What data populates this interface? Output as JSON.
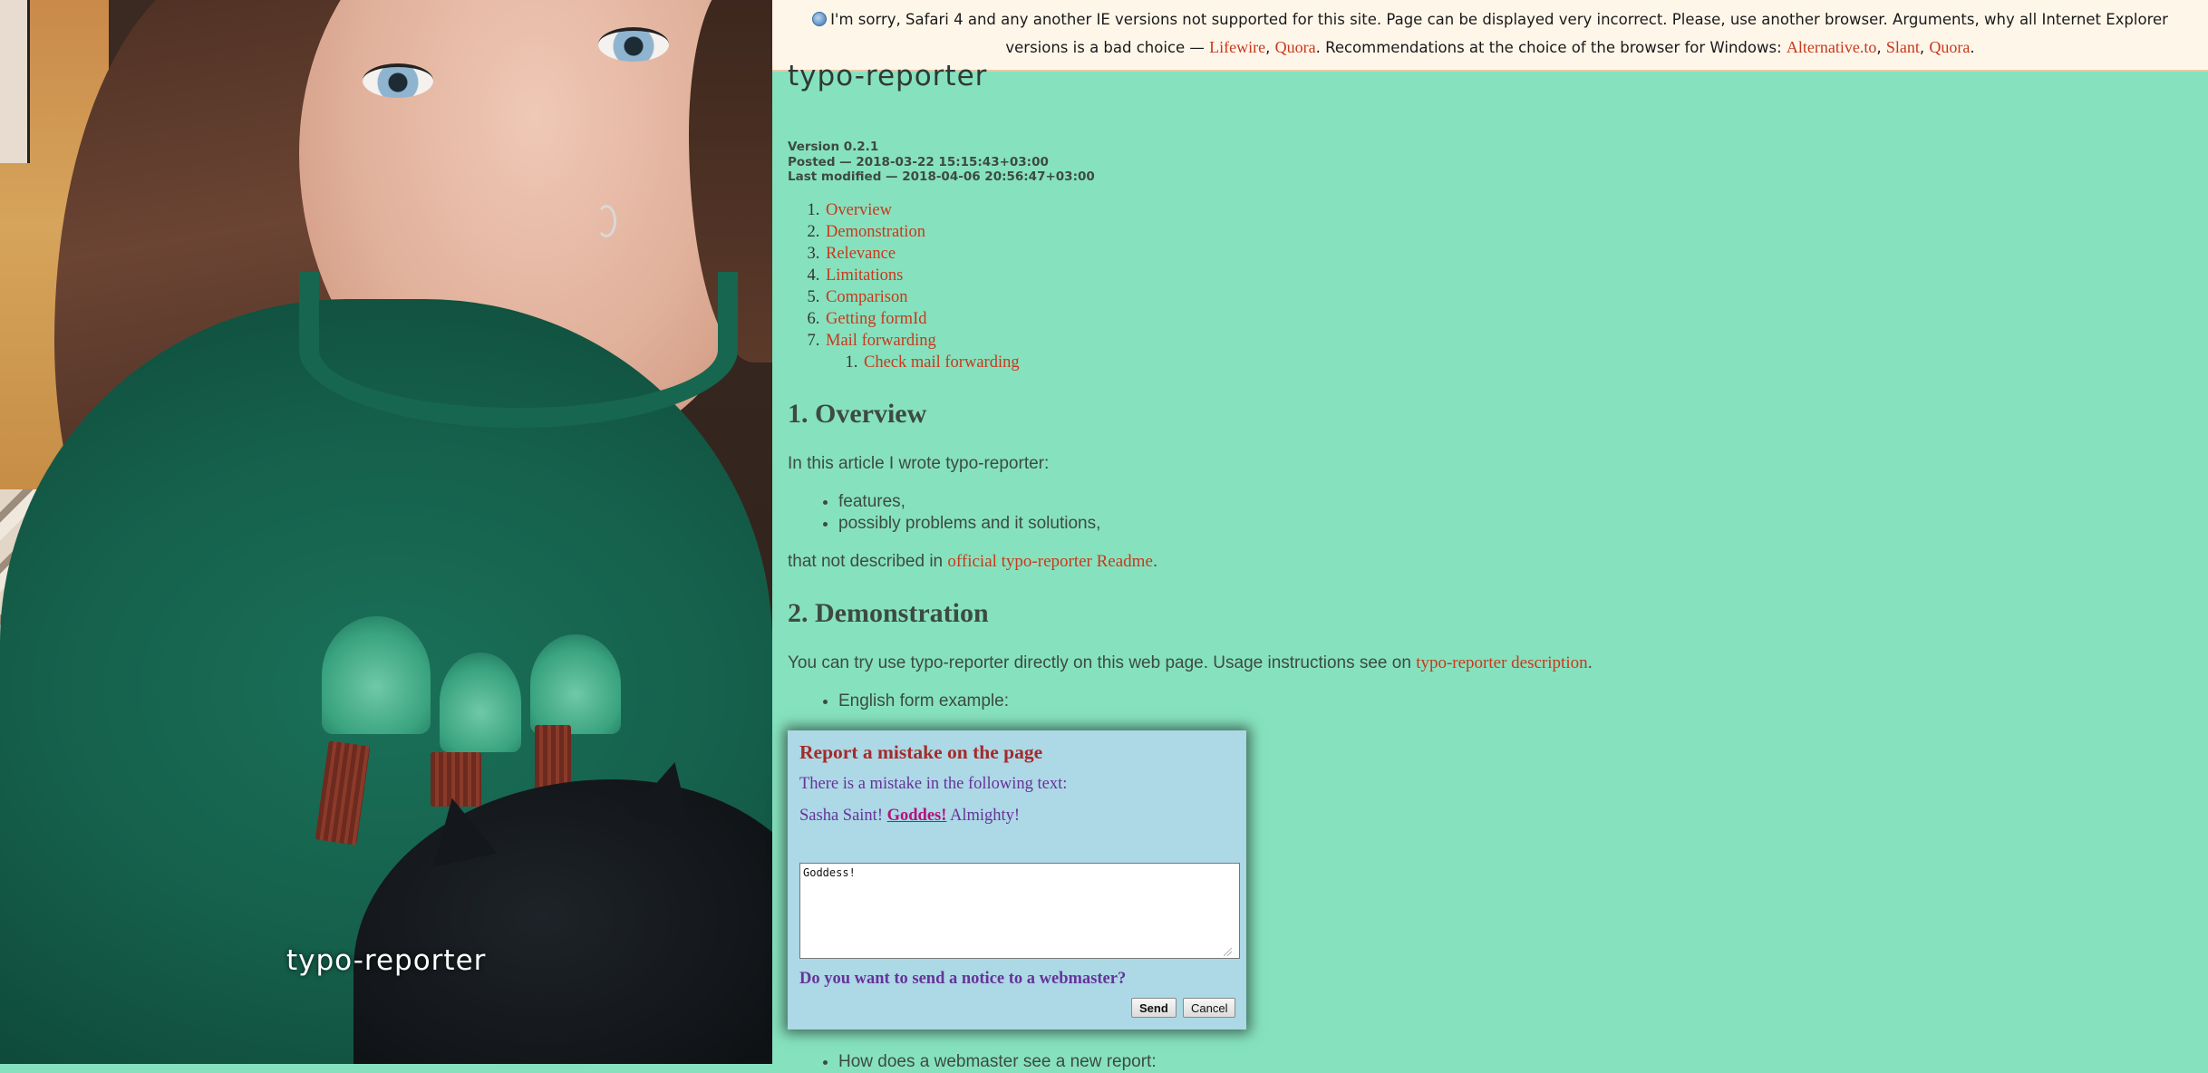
{
  "banner": {
    "text_before": "I'm sorry, Safari 4 and any another IE versions not supported for this site. Page can be displayed very incorrect. Please, use another browser. Arguments, why all Internet Explorer versions is a bad choice — ",
    "link_lifewire": "Lifewire",
    "sep1": ", ",
    "link_quora1": "Quora",
    "text_mid": ". Recommendations at the choice of the browser for Windows: ",
    "link_alternative": "Alternative.to",
    "sep2": ", ",
    "link_slant": "Slant",
    "sep3": ", ",
    "link_quora2": "Quora",
    "text_end": "."
  },
  "photo": {
    "caption": "typo-reporter"
  },
  "page": {
    "title": "typo-reporter",
    "version": "Version 0.2.1",
    "posted": "Posted — 2018-03-22 15:15:43+03:00",
    "modified": "Last modified — 2018-04-06 20:56:47+03:00"
  },
  "toc": {
    "items": [
      "Overview",
      "Demonstration",
      "Relevance",
      "Limitations",
      "Comparison",
      "Getting formId",
      "Mail forwarding"
    ],
    "subitems": [
      "Check mail forwarding"
    ]
  },
  "overview": {
    "heading": "1. Overview",
    "intro": "In this article I wrote typo-reporter:",
    "bullets": [
      "features,",
      "possibly problems and it solutions,"
    ],
    "outro_text": "that not described in ",
    "outro_link": "official typo-reporter Readme",
    "outro_end": "."
  },
  "demonstration": {
    "heading": "2. Demonstration",
    "text": "You can try use typo-reporter directly on this web page. Usage instructions see on ",
    "link": "typo-reporter description",
    "end": ".",
    "bullet": "English form example:",
    "bullet_after": "How does a webmaster see a new report:"
  },
  "dialog": {
    "title": "Report a mistake on the page",
    "subtitle": "There is a mistake in the following text:",
    "quote_before": "Sasha Saint! ",
    "quote_mistake": "Goddes!",
    "quote_after": " Almighty!",
    "correction_value": "Goddess!",
    "question": "Do you want to send a notice to a webmaster?",
    "send_label": "Send",
    "cancel_label": "Cancel"
  },
  "colors": {
    "background": "#86e2be",
    "link": "#c8381c",
    "dialog_bg": "#add8e6",
    "dialog_title": "#a52a2a",
    "dialog_text": "#663399",
    "mistake": "#b3127a"
  },
  "icons": {
    "banner": "browser-globe-icon"
  }
}
